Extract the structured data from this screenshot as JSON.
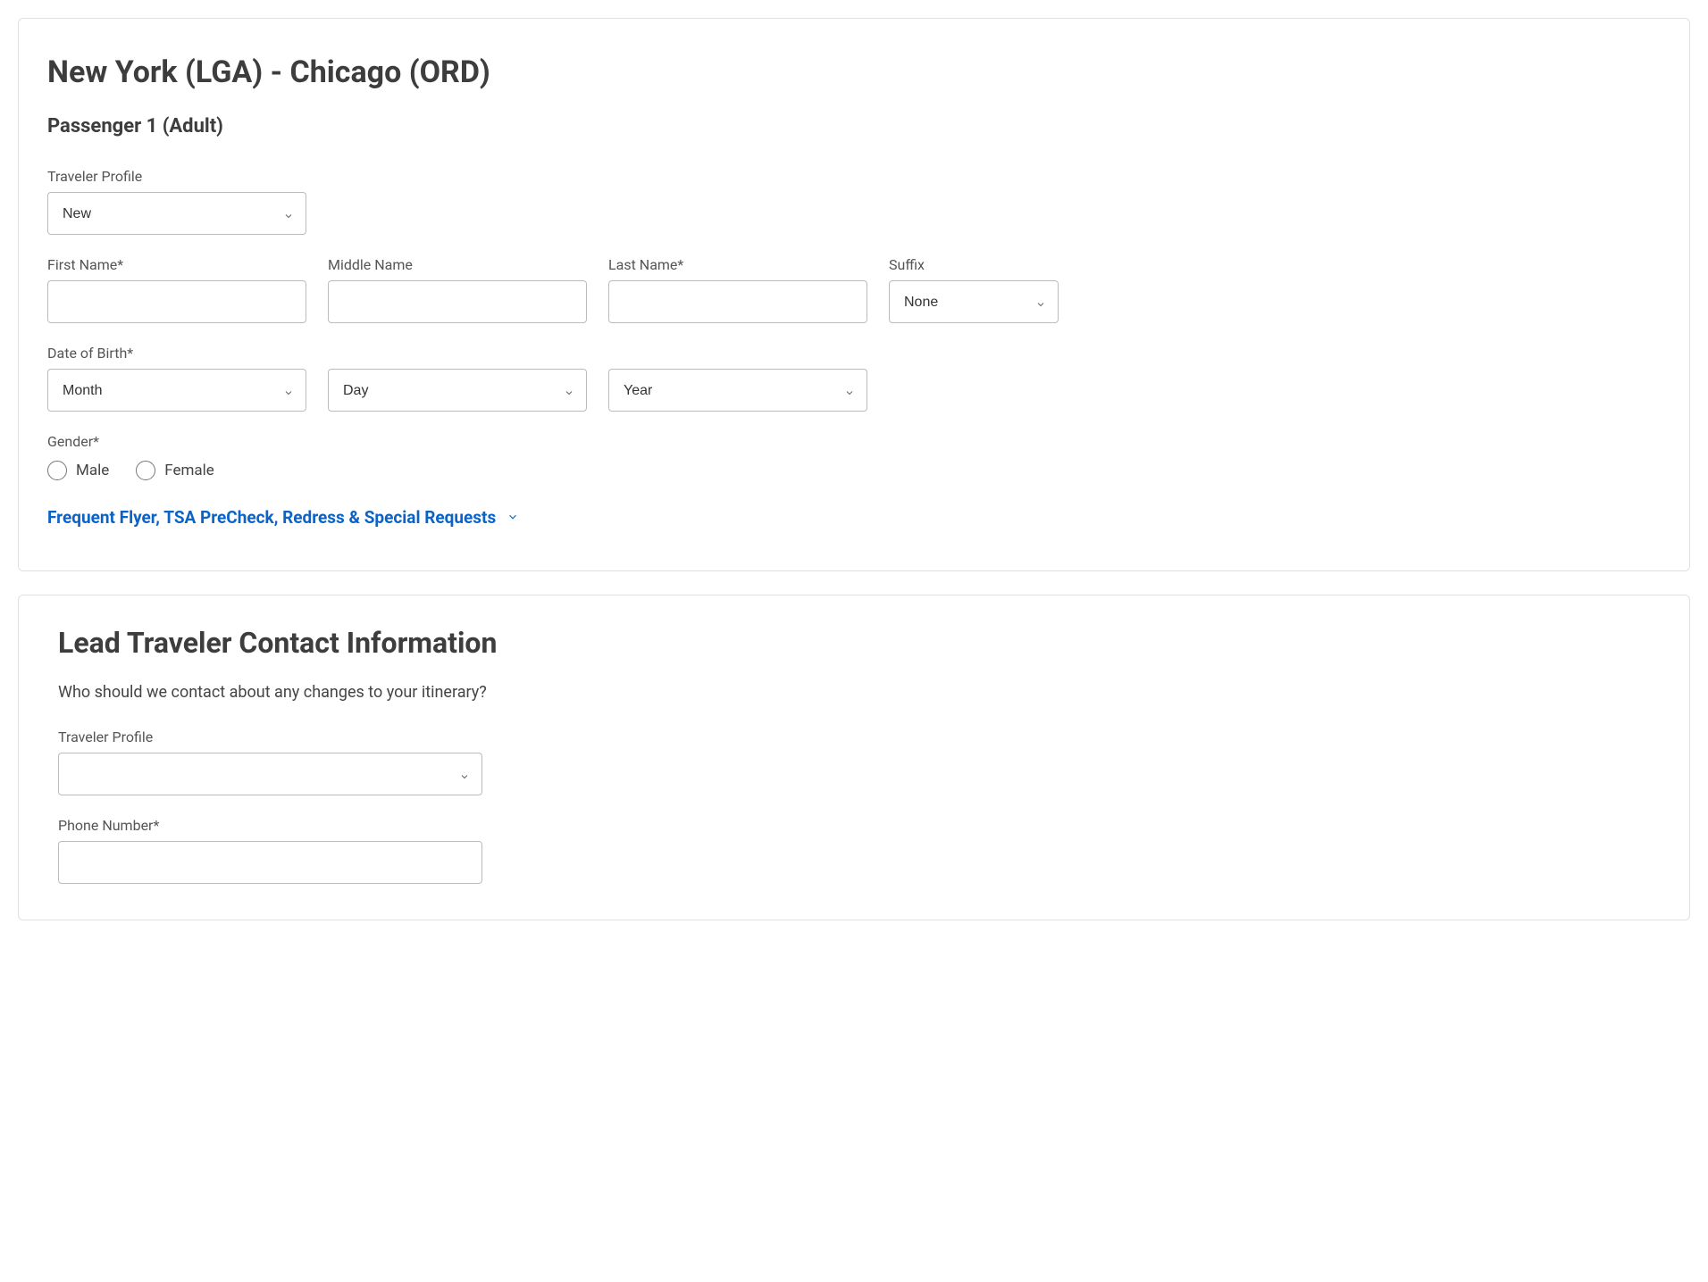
{
  "passenger_card": {
    "route_title": "New York (LGA) - Chicago (ORD)",
    "passenger_heading": "Passenger 1 (Adult)",
    "traveler_profile": {
      "label": "Traveler Profile",
      "value": "New"
    },
    "first_name": {
      "label": "First Name*",
      "value": ""
    },
    "middle_name": {
      "label": "Middle Name",
      "value": ""
    },
    "last_name": {
      "label": "Last Name*",
      "value": ""
    },
    "suffix": {
      "label": "Suffix",
      "value": "None"
    },
    "dob": {
      "label": "Date of Birth*",
      "month": "Month",
      "day": "Day",
      "year": "Year"
    },
    "gender": {
      "label": "Gender*",
      "male": "Male",
      "female": "Female"
    },
    "expand_link": "Frequent Flyer, TSA PreCheck, Redress & Special Requests"
  },
  "contact_card": {
    "title": "Lead Traveler Contact Information",
    "subtitle": "Who should we contact about any changes to your itinerary?",
    "traveler_profile": {
      "label": "Traveler Profile",
      "value": ""
    },
    "phone": {
      "label": "Phone Number*",
      "value": ""
    }
  }
}
